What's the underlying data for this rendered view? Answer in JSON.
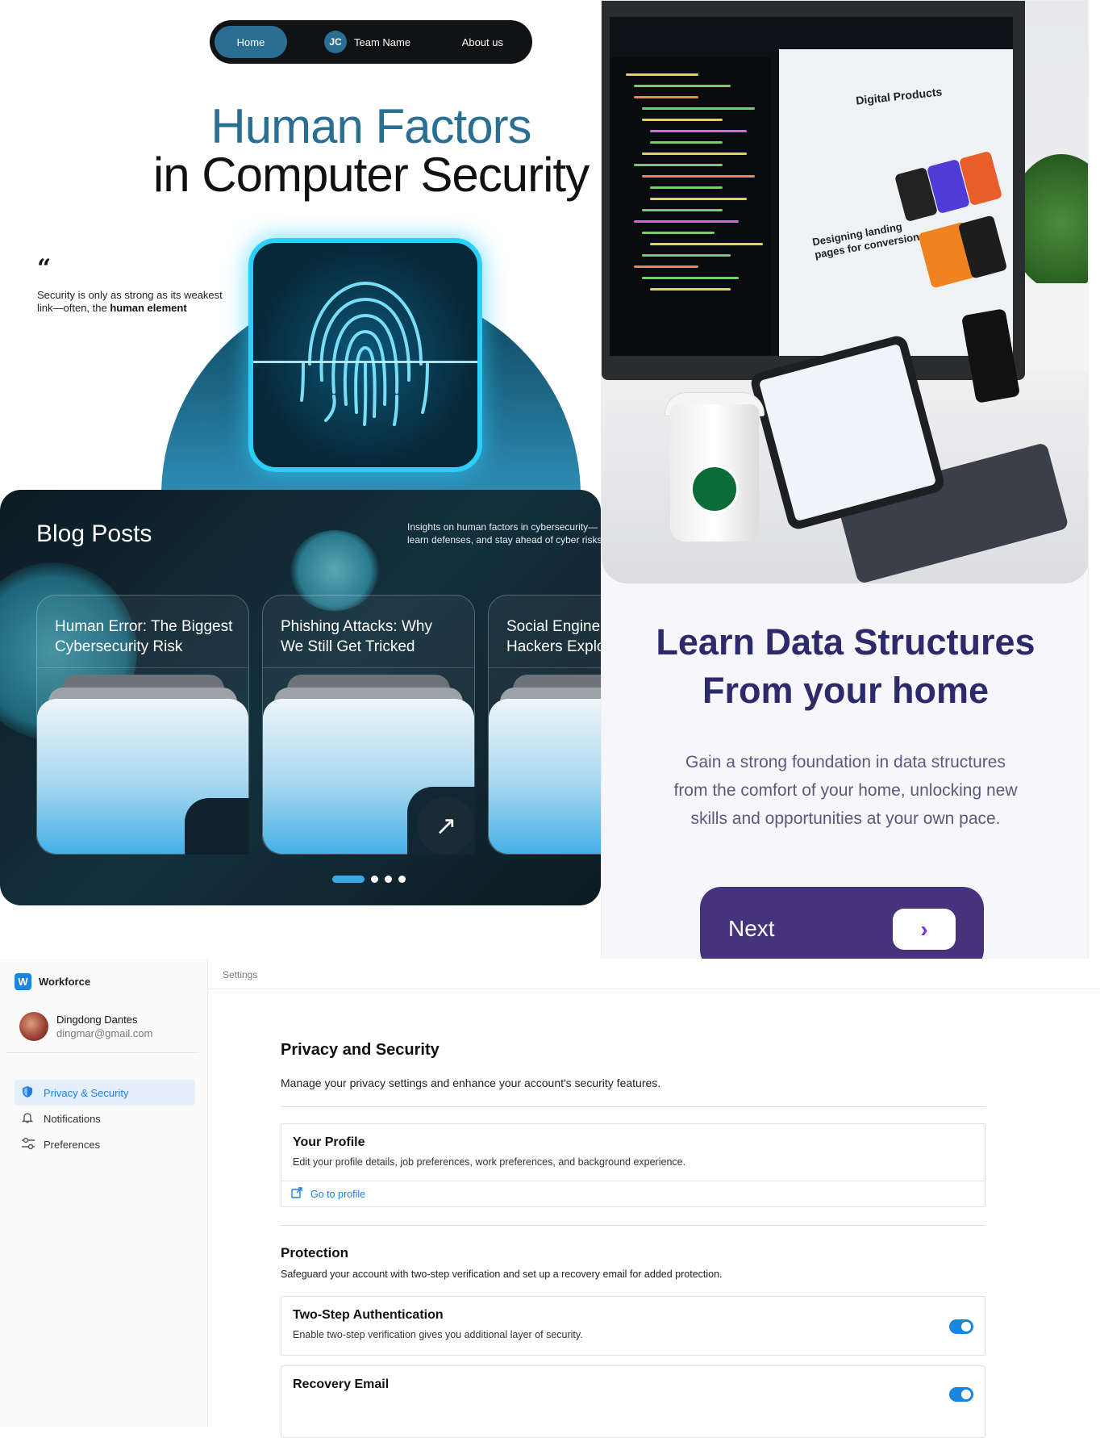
{
  "hero": {
    "nav": {
      "home": "Home",
      "logo_text": "JC",
      "team": "Team Name",
      "about": "About us"
    },
    "title_line1": "Human Factors",
    "title_line2": "in Computer Security",
    "quote_mark": "“",
    "quote_text": "Security is only as strong as its weakest link—often, the ",
    "quote_emphasis": "human element"
  },
  "blog": {
    "title": "Blog Posts",
    "description_line1": "Insights on human factors in cybersecurity—",
    "description_line2": "learn defenses, and stay ahead of cyber risks",
    "posts": [
      {
        "title_line1": "Human Error: The Biggest",
        "title_line2": "Cybersecurity Risk"
      },
      {
        "title_line1": "Phishing Attacks: Why",
        "title_line2": "We Still Get Tricked"
      },
      {
        "title_line1": "Social Enginee",
        "title_line2": "Hackers Explo"
      }
    ],
    "arrow_icon": "↗",
    "pagination": {
      "pages": 4,
      "active": 0
    }
  },
  "data_structures": {
    "photo": {
      "web_title": "Digital Products",
      "web_subtitle_line1": "Designing landing",
      "web_subtitle_line2": "pages for conversion"
    },
    "title_line1": "Learn Data Structures",
    "title_line2": "From your home",
    "body_line1": "Gain a strong foundation in data structures",
    "body_line2": "from the comfort of your home, unlocking new",
    "body_line3": "skills and opportunities at your own pace.",
    "next_label": "Next",
    "next_icon": "›",
    "colors": {
      "primary": "#46337e",
      "title": "#2d2a6b"
    }
  },
  "settings": {
    "brand": {
      "logo": "W",
      "name": "Workforce"
    },
    "user": {
      "name": "Dingdong Dantes",
      "email": "dingmar@gmail.com"
    },
    "sidebar": [
      {
        "label": "Privacy & Security",
        "icon": "shield-icon",
        "active": true
      },
      {
        "label": "Notifications",
        "icon": "bell-icon",
        "active": false
      },
      {
        "label": "Preferences",
        "icon": "sliders-icon",
        "active": false
      }
    ],
    "breadcrumb": "Settings",
    "title": "Privacy and Security",
    "subtitle": "Manage your privacy settings and enhance your account's security features.",
    "profile": {
      "title": "Your Profile",
      "description": "Edit your profile details, job preferences, work preferences, and background experience.",
      "link": "Go to profile"
    },
    "protection": {
      "title": "Protection",
      "description": "Safeguard your account with two-step verification and set up a recovery email for added protection.",
      "two_step": {
        "title": "Two-Step Authentication",
        "description": "Enable two-step verification gives you additional layer of security.",
        "enabled": true
      },
      "recovery": {
        "title": "Recovery Email",
        "enabled": true
      }
    },
    "colors": {
      "accent": "#1b86e0"
    }
  }
}
